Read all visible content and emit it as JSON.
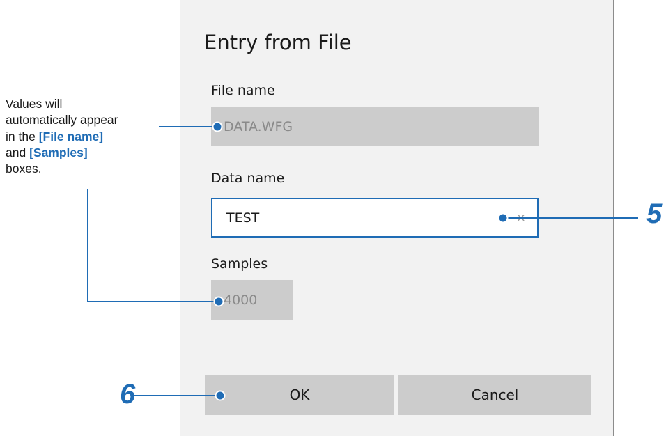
{
  "dialog": {
    "title": "Entry from File",
    "file_name": {
      "label": "File name",
      "value": "DATA.WFG"
    },
    "data_name": {
      "label": "Data name",
      "value": "TEST",
      "clear_icon": "×"
    },
    "samples": {
      "label": "Samples",
      "value": "4000"
    },
    "ok_label": "OK",
    "cancel_label": "Cancel"
  },
  "annotation": {
    "line1": "Values will",
    "line2": "automatically appear",
    "line3_prefix": "in the ",
    "line3_highlight": "[File name]",
    "line4_prefix": "and ",
    "line4_highlight": "[Samples]",
    "line5": "boxes."
  },
  "callouts": {
    "step5": "5",
    "step6": "6"
  },
  "colors": {
    "accent": "#1f6cb5",
    "dialog_bg": "#f2f2f2",
    "readonly_field": "#cccccc"
  },
  "icons": {
    "clear": "clear-x-icon",
    "pointer": "callout-dot-icon"
  }
}
